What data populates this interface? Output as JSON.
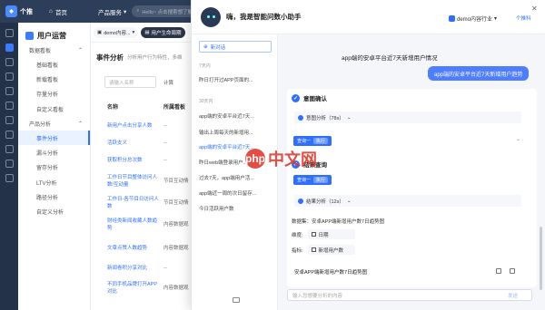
{
  "topbar": {
    "logo_text": "个推",
    "home_label": "首页",
    "product_label": "产品服务",
    "search_placeholder": "Hello~ 点击搜索想了解的内容"
  },
  "subnav": {
    "title": "用户运营",
    "groups": [
      {
        "label": "数据看板",
        "items": [
          "基础看板",
          "新载看板",
          "存量分析",
          "自定义看板"
        ]
      },
      {
        "label": "产品分析",
        "items": [
          "事件分析",
          "漏斗分析",
          "留存分析",
          "LTV分析",
          "路径分析",
          "自定义分析"
        ]
      }
    ],
    "active_item": "事件分析"
  },
  "header2": {
    "app_select": "demo内容...",
    "product_tab": "用户生命周期"
  },
  "event_page": {
    "title": "事件分析",
    "desc": "分析用户行为特性，多维",
    "search_placeholder": "请输入名称",
    "time_label": "计算",
    "columns": [
      "名称",
      "所属看板"
    ],
    "rows": [
      {
        "name": "新用户点击分享人数",
        "board": "--"
      },
      {
        "name": "活跃支义",
        "board": "--"
      },
      {
        "name": "获取积分总次数",
        "board": "--"
      },
      {
        "name": "工作日节目整体访问人数/互动量",
        "board": "节目互动情"
      },
      {
        "name": "工作日-各节目日访问人数",
        "board": "节目互动情"
      },
      {
        "name": "财经类新闻收藏人数趋势",
        "board": "内容数据观"
      },
      {
        "name": "文章点赞人数趋势",
        "board": "内容数据观"
      },
      {
        "name": "新闻卷积分享对比",
        "board": "--"
      },
      {
        "name": "不同手机品牌打开APP对比",
        "board": "内容数据观"
      }
    ]
  },
  "assistant": {
    "title": "嗨，我是智能问数小助手",
    "tenant": "demo内容行业",
    "switch_label": "个推科",
    "new_chat": "新对话",
    "history_groups": [
      {
        "label": "7天内",
        "items": [
          "昨日打开过APP页面的..."
        ]
      },
      {
        "label": "30天内",
        "items": [
          "app端的安卓平台近7天...",
          "输出上周每天的新增用...",
          "app端的安卓平台近7天...",
          "昨日web端登录用户...",
          "过去7天，app端用户活...",
          "app端近一周的次日留存...",
          "今日活跃用户数"
        ]
      }
    ],
    "active_history_index": 2,
    "chat_title": "app端的安卓平台近7天新增用户情况",
    "user_message": "app端的安卓平台近7天新增用户趋势",
    "step1_title": "意图确认",
    "step1_analysis": "意图分析（78s）",
    "query_btn": "查询一",
    "exec_btn": "执行",
    "step2_title": "结果查询",
    "step2_analysis": "结果分析（12s）",
    "dataset_text": "数据集：安卓APP端新增用户数7日趋势图",
    "dimension_label": "维度:",
    "dimension_value": "日期",
    "metric_label": "指标:",
    "metric_value": "新增用户数",
    "chart_title": "安卓APP端新增用户数7日趋势图",
    "input_placeholder": "输入您想要分析的内容",
    "send_label": "发送"
  },
  "watermark": {
    "text": "中文网",
    "badge": "php"
  }
}
